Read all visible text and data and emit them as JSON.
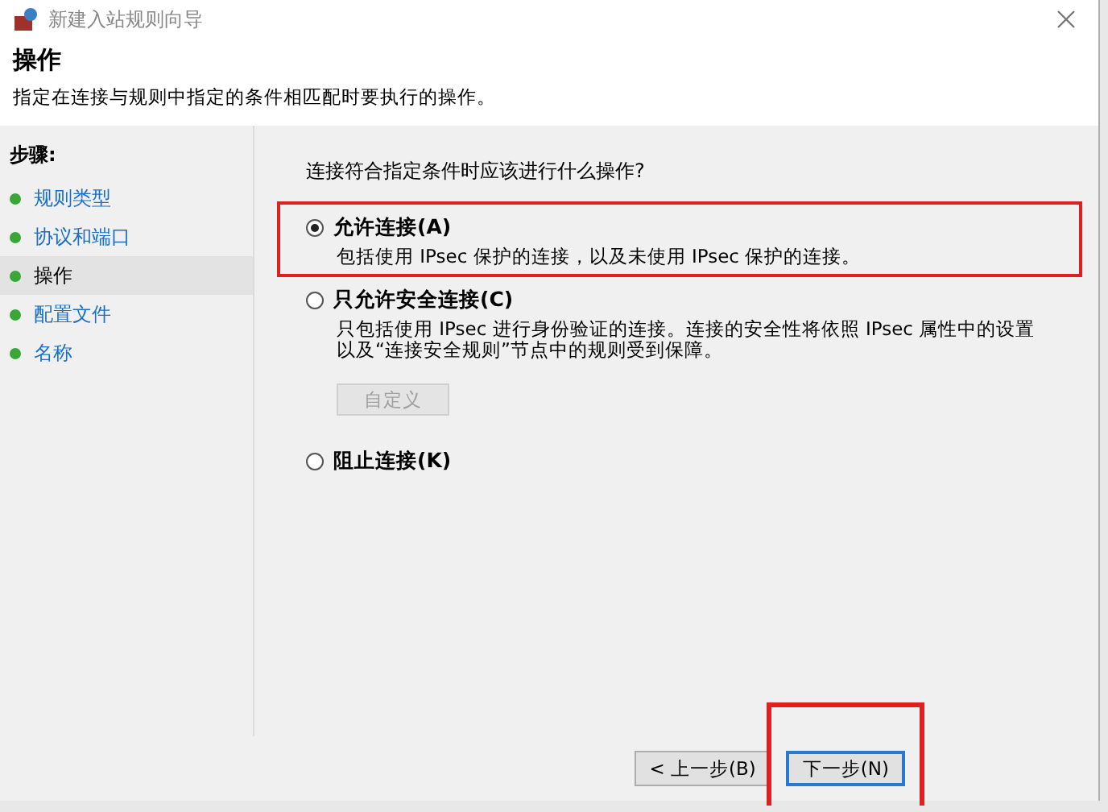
{
  "window": {
    "title": "新建入站规则向导"
  },
  "header": {
    "title": "操作",
    "description": "指定在连接与规则中指定的条件相匹配时要执行的操作。"
  },
  "steps": {
    "title": "步骤:",
    "items": [
      {
        "label": "规则类型",
        "selected": false
      },
      {
        "label": "协议和端口",
        "selected": false
      },
      {
        "label": "操作",
        "selected": true
      },
      {
        "label": "配置文件",
        "selected": false
      },
      {
        "label": "名称",
        "selected": false
      }
    ]
  },
  "question": "连接符合指定条件时应该进行什么操作?",
  "options": [
    {
      "label": "允许连接(A)",
      "description": "包括使用 IPsec 保护的连接，以及未使用 IPsec 保护的连接。",
      "selected": true,
      "highlighted": true
    },
    {
      "label": "只允许安全连接(C)",
      "description": "只包括使用 IPsec 进行身份验证的连接。连接的安全性将依照 IPsec 属性中的设置以及“连接安全规则”节点中的规则受到保障。",
      "selected": false,
      "highlighted": false,
      "button": {
        "label": "自定义",
        "disabled": true
      }
    },
    {
      "label": "阻止连接(K)",
      "selected": false,
      "highlighted": false
    }
  ],
  "nav_buttons": [
    {
      "label": "< 上一步(B)",
      "default": false,
      "highlighted": false
    },
    {
      "label": "下一步(N)",
      "default": true,
      "highlighted": true
    }
  ]
}
